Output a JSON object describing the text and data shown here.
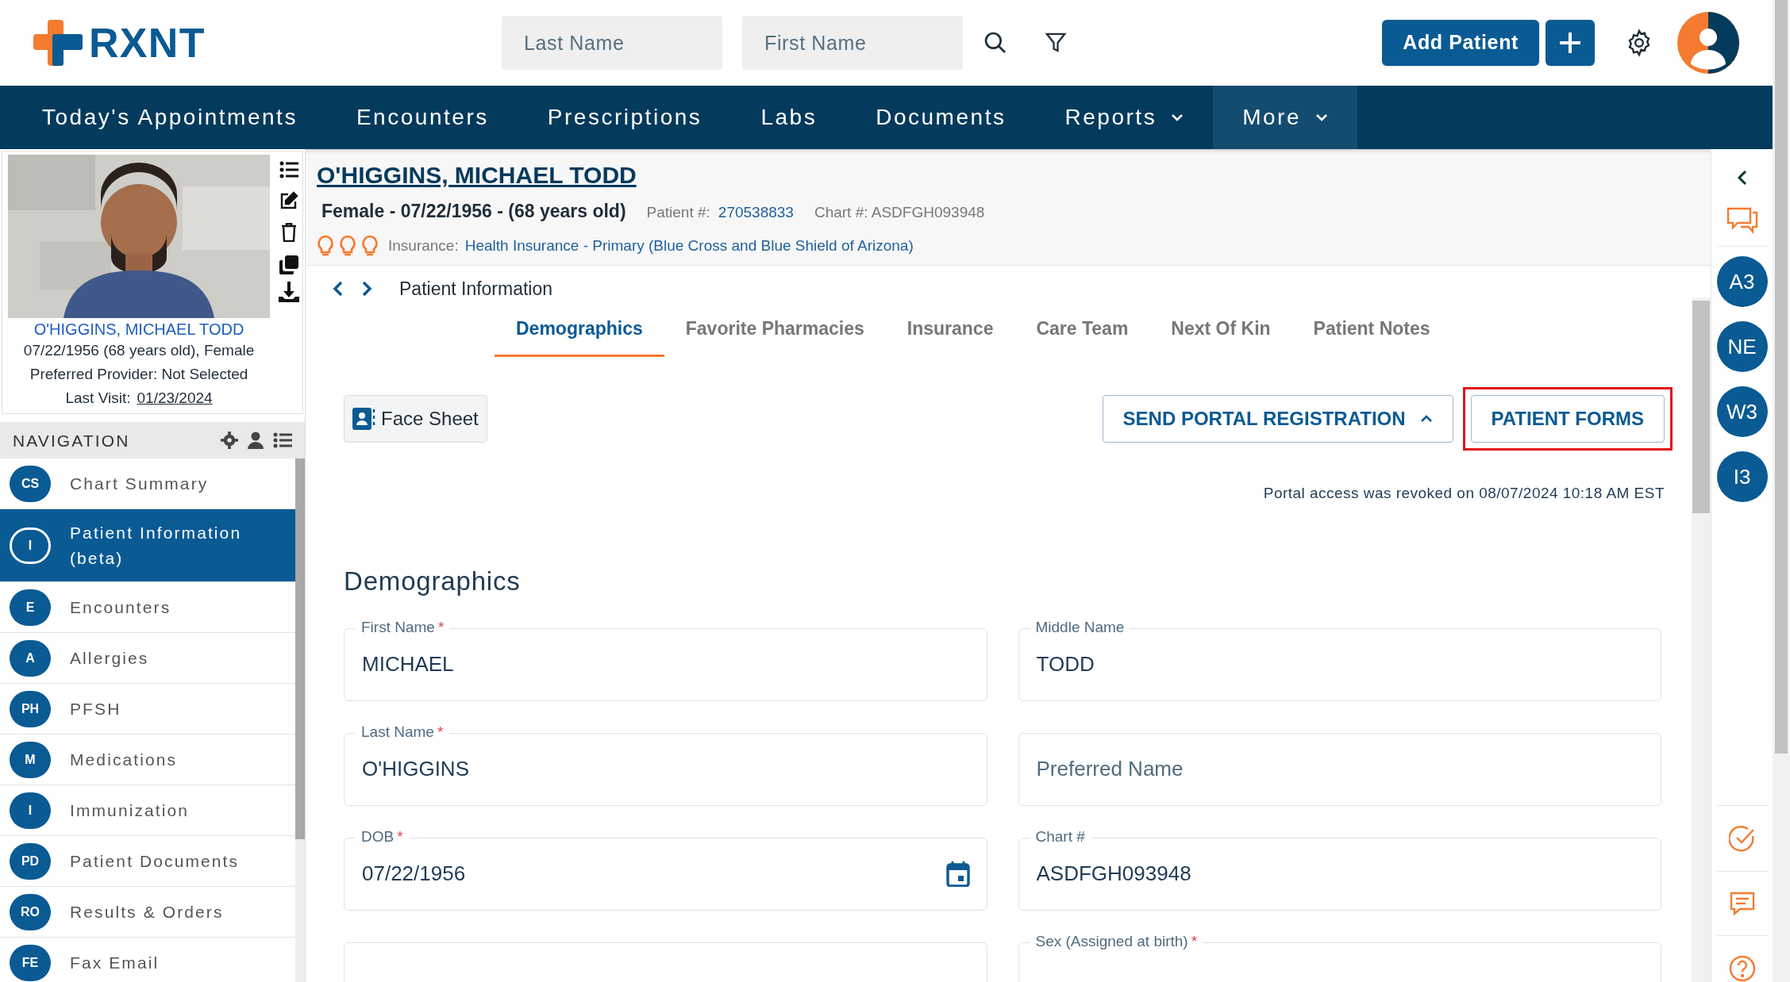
{
  "header": {
    "logo": "RXNT",
    "search_fields": [
      {
        "placeholder": "Last Name"
      },
      {
        "placeholder": "First Name"
      }
    ],
    "add_button": "Add Patient"
  },
  "nav": [
    {
      "label": "Today's Appointments",
      "has_menu": false,
      "selected": false
    },
    {
      "label": "Encounters",
      "has_menu": false,
      "selected": false
    },
    {
      "label": "Prescriptions",
      "has_menu": false,
      "selected": false
    },
    {
      "label": "Labs",
      "has_menu": false,
      "selected": false
    },
    {
      "label": "Documents",
      "has_menu": false,
      "selected": false
    },
    {
      "label": "Reports",
      "has_menu": true,
      "selected": false
    },
    {
      "label": "More",
      "has_menu": true,
      "selected": true
    }
  ],
  "patient_card": {
    "name": "O'HIGGINS, MICHAEL TODD",
    "info": "07/22/1956 (68 years old), Female",
    "provider": "Preferred Provider: Not Selected",
    "last_visit_label": "Last Visit:",
    "last_visit": "01/23/2024"
  },
  "navigation": {
    "title": "NAVIGATION",
    "items": [
      {
        "badge": "CS",
        "label": "Chart Summary",
        "selected": false
      },
      {
        "badge": "I",
        "label": "Patient Information (beta)",
        "selected": true
      },
      {
        "badge": "E",
        "label": "Encounters",
        "selected": false
      },
      {
        "badge": "A",
        "label": "Allergies",
        "selected": false
      },
      {
        "badge": "PH",
        "label": "PFSH",
        "selected": false
      },
      {
        "badge": "M",
        "label": "Medications",
        "selected": false
      },
      {
        "badge": "I",
        "label": "Immunization",
        "selected": false
      },
      {
        "badge": "PD",
        "label": "Patient Documents",
        "selected": false
      },
      {
        "badge": "RO",
        "label": "Results & Orders",
        "selected": false
      },
      {
        "badge": "FE",
        "label": "Fax Email",
        "selected": false
      }
    ]
  },
  "patient_header": {
    "name": "O'HIGGINS, MICHAEL TODD",
    "summary": "Female - 07/22/1956 - (68 years old)",
    "patient_label": "Patient #:",
    "patient_number": "270538833",
    "chart": "Chart #: ASDFGH093948",
    "insurance_label": "Insurance:",
    "insurance": "Health Insurance - Primary (Blue Cross and Blue Shield of Arizona)"
  },
  "breadcrumb": "Patient Information",
  "tabs": [
    {
      "label": "Demographics",
      "selected": true
    },
    {
      "label": "Favorite Pharmacies",
      "selected": false
    },
    {
      "label": "Insurance",
      "selected": false
    },
    {
      "label": "Care Team",
      "selected": false
    },
    {
      "label": "Next Of Kin",
      "selected": false
    },
    {
      "label": "Patient Notes",
      "selected": false
    }
  ],
  "face_sheet": "Face Sheet",
  "actions": [
    {
      "label": "SEND PORTAL REGISTRATION",
      "kind": "dropdown",
      "highlighted": false
    },
    {
      "label": "PATIENT FORMS",
      "kind": "plain",
      "highlighted": true
    }
  ],
  "portal_note": "Portal access was revoked on 08/07/2024 10:18 AM EST",
  "section_title": "Demographics",
  "fields": [
    {
      "label": "First Name",
      "required_mark": "*",
      "value": "MICHAEL",
      "kind": "text"
    },
    {
      "label": "Middle Name",
      "value": "TODD",
      "kind": "text"
    },
    {
      "label": "Last Name",
      "required_mark": "*",
      "value": "O'HIGGINS",
      "kind": "text"
    },
    {
      "placeholder": "Preferred Name",
      "kind": "text"
    },
    {
      "label": "DOB",
      "required_mark": "*",
      "value": "07/22/1956",
      "kind": "date"
    },
    {
      "label": "Chart #",
      "value": "ASDFGH093948",
      "kind": "text"
    },
    {
      "kind": "text"
    },
    {
      "label": "Sex (Assigned at birth)",
      "required_mark": "*",
      "kind": "text"
    }
  ],
  "rail_badges": [
    "A3",
    "NE",
    "W3",
    "I3"
  ]
}
